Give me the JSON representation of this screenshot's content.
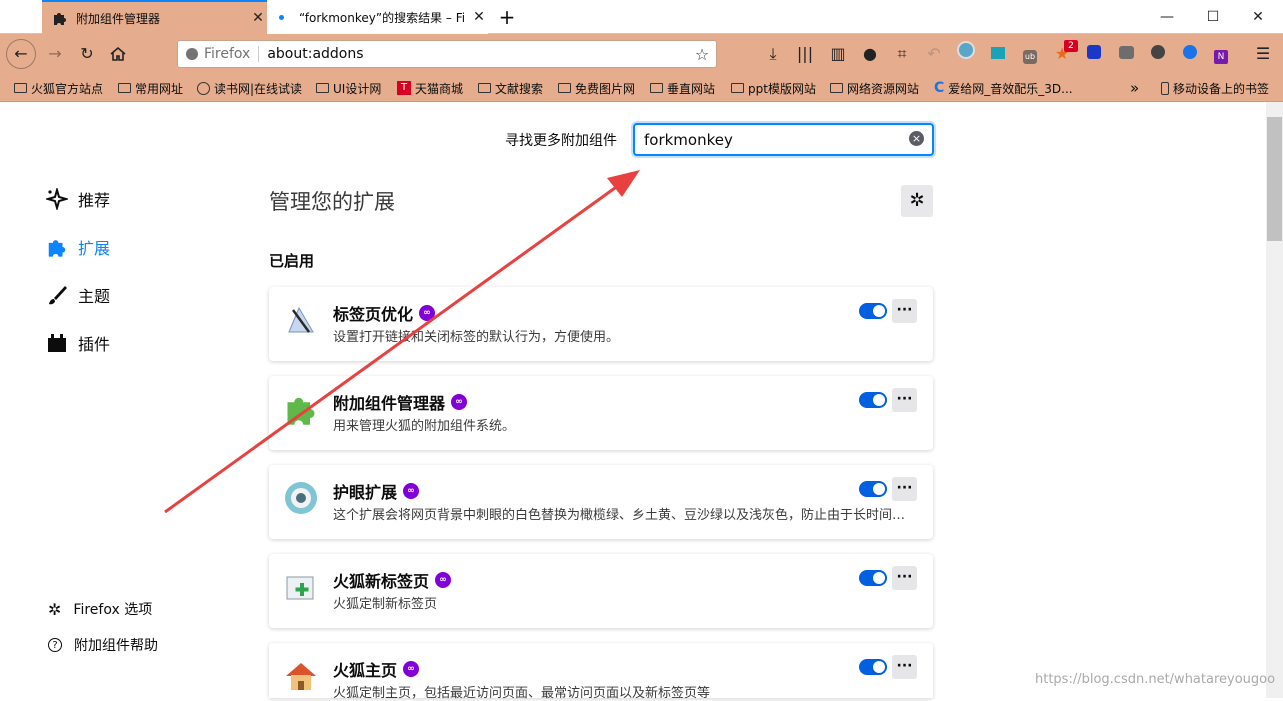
{
  "tabs": [
    {
      "label": "附加组件管理器",
      "active": true
    },
    {
      "label": "“forkmonkey”的搜索结果 – Fi",
      "active": false
    }
  ],
  "window_controls": {
    "minimize": "—",
    "maximize": "☐",
    "close": "✕"
  },
  "urlbar": {
    "identity": "Firefox",
    "url": "about:addons"
  },
  "bookmarks": [
    "火狐官方站点",
    "常用网址",
    "读书网|在线试读",
    "UI设计网",
    "天猫商城",
    "文献搜索",
    "免费图片网",
    "垂直网站",
    "ppt模版网站",
    "网络资源网站",
    "爱给网_音效配乐_3D...",
    "移动设备上的书签"
  ],
  "toolbar_badge": "2",
  "search": {
    "label": "寻找更多附加组件",
    "value": "forkmonkey"
  },
  "sidebar": {
    "categories": [
      {
        "label": "推荐",
        "icon": "sparkle-icon",
        "active": false
      },
      {
        "label": "扩展",
        "icon": "puzzle-icon",
        "active": true
      },
      {
        "label": "主题",
        "icon": "brush-icon",
        "active": false
      },
      {
        "label": "插件",
        "icon": "plugin-icon",
        "active": false
      }
    ],
    "footer": [
      {
        "label": "Firefox 选项",
        "icon": "gear-icon"
      },
      {
        "label": "附加组件帮助",
        "icon": "help-icon"
      }
    ]
  },
  "main": {
    "title": "管理您的扩展",
    "section_enabled": "已启用",
    "extensions": [
      {
        "name": "标签页优化",
        "desc": "设置打开链接和关闭标签的默认行为，方便使用。",
        "enabled": true
      },
      {
        "name": "附加组件管理器",
        "desc": "用来管理火狐的附加组件系统。",
        "enabled": true
      },
      {
        "name": "护眼扩展",
        "desc": "这个扩展会将网页背景中刺眼的白色替换为橄榄绿、乡土黄、豆沙绿以及浅灰色，防止由于长时间盯着屏幕而导致眼睛疲劳",
        "enabled": true
      },
      {
        "name": "火狐新标签页",
        "desc": "火狐定制新标签页",
        "enabled": true
      },
      {
        "name": "火狐主页",
        "desc": "火狐定制主页，包括最近访问页面、最常访问页面以及新标签页等",
        "enabled": true
      }
    ]
  },
  "watermark": "https://blog.csdn.net/whatareyougoo",
  "colors": {
    "chrome": "#e5ad8e",
    "accent": "#0a84ff",
    "toggle": "#0060df",
    "badge": "#8000d7",
    "arrow": "#e8413f"
  }
}
